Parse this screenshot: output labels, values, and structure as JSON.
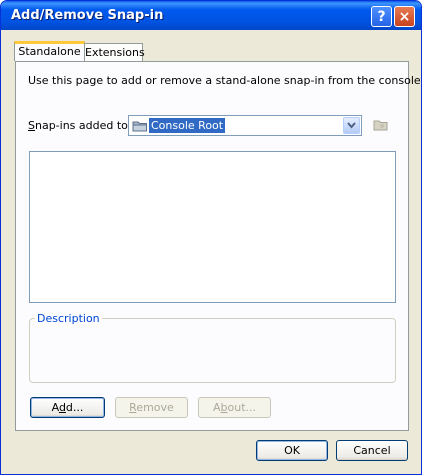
{
  "window": {
    "title": "Add/Remove Snap-in",
    "help_button": "?",
    "close_button": "×"
  },
  "tabs": [
    {
      "label": "Standalone",
      "active": true
    },
    {
      "label": "Extensions",
      "active": false
    }
  ],
  "standalone": {
    "instructions": "Use this page to add or remove a stand-alone snap-in from the console.",
    "snapins_label_prefix": "",
    "snapins_label_key": "S",
    "snapins_label_rest": "nap-ins added to:",
    "snapins_selected": "Console Root",
    "snapin_items": [],
    "description_legend": "Description",
    "description_text": ""
  },
  "buttons": {
    "add_pre": "A",
    "add_key": "d",
    "add_post": "d...",
    "remove_pre": "",
    "remove_key": "R",
    "remove_post": "emove",
    "about_pre": "A",
    "about_key": "b",
    "about_post": "out...",
    "ok": "OK",
    "cancel": "Cancel"
  },
  "icons": {
    "folder": "folder-icon",
    "dropdown": "chevron-down-icon",
    "browse": "browse-folder-icon"
  },
  "colors": {
    "title_bar": "#0054e3",
    "tab_highlight": "#ffc83c",
    "selection": "#316ac5",
    "legend": "#0046d5"
  }
}
